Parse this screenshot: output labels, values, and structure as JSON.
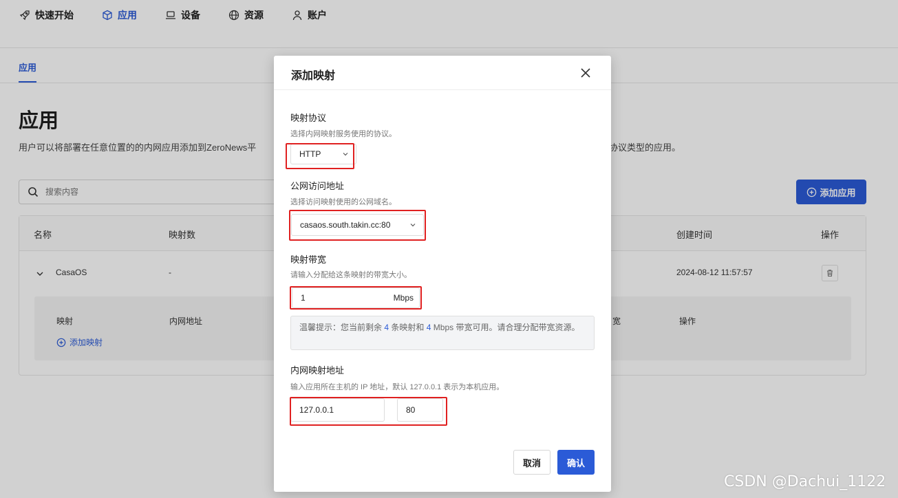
{
  "nav": {
    "items": [
      {
        "label": "快速开始",
        "icon": "rocket-icon"
      },
      {
        "label": "应用",
        "icon": "cube-icon"
      },
      {
        "label": "设备",
        "icon": "laptop-icon"
      },
      {
        "label": "资源",
        "icon": "globe-icon"
      },
      {
        "label": "账户",
        "icon": "user-icon"
      }
    ],
    "active": "应用"
  },
  "subtab": "应用",
  "page": {
    "title": "应用",
    "description_head": "用户可以将部署在任意位置的的内网应用添加到ZeroNews平",
    "description_tail": "协议类型的应用。"
  },
  "search": {
    "placeholder": "搜索内容"
  },
  "add_app_button": "添加应用",
  "table": {
    "headers": [
      "名称",
      "映射数",
      "创建时间",
      "操作"
    ],
    "row": {
      "name": "CasaOS",
      "mappings": "-",
      "created": "2024-08-12 11:57:57"
    },
    "inner_headers": [
      "映射",
      "内网地址",
      "宽",
      "操作"
    ],
    "add_mapping": "添加映射"
  },
  "modal": {
    "title": "添加映射",
    "protocol": {
      "label": "映射协议",
      "hint": "选择内网映射服务使用的协议。",
      "value": "HTTP"
    },
    "domain": {
      "label": "公网访问地址",
      "hint": "选择访问映射使用的公网域名。",
      "value": "casaos.south.takin.cc:80"
    },
    "bandwidth": {
      "label": "映射带宽",
      "hint": "请输入分配给这条映射的带宽大小。",
      "value": "1",
      "unit": "Mbps"
    },
    "tip": {
      "prefix": "温馨提示：您当前剩余",
      "mappings": "4",
      "middle": "条映射和",
      "bandwidth": "4",
      "suffix": "Mbps 带宽可用。请合理分配带宽资源。"
    },
    "internal": {
      "label": "内网映射地址",
      "hint": "输入应用所在主机的 IP 地址，默认 127.0.0.1 表示为本机应用。",
      "ip": "127.0.0.1",
      "port": "80"
    },
    "cancel": "取消",
    "confirm": "确认"
  },
  "colors": {
    "accent": "#2b5bd7",
    "highlight": "#e02020"
  },
  "watermark": "CSDN @Dachui_1122"
}
